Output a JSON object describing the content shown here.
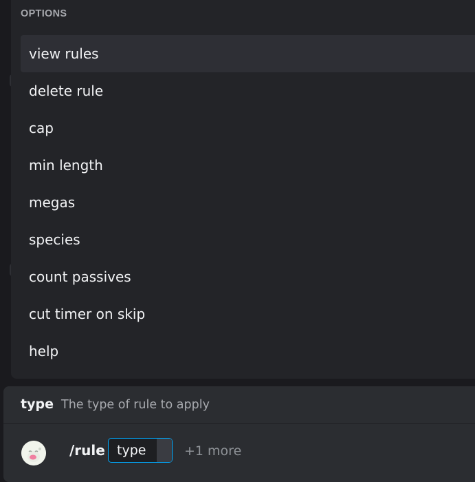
{
  "options": {
    "header": "OPTIONS",
    "items": [
      {
        "label": "view rules",
        "active": true
      },
      {
        "label": "delete rule",
        "active": false
      },
      {
        "label": "cap",
        "active": false
      },
      {
        "label": "min length",
        "active": false
      },
      {
        "label": "megas",
        "active": false
      },
      {
        "label": "species",
        "active": false
      },
      {
        "label": "count passives",
        "active": false
      },
      {
        "label": "cut timer on skip",
        "active": false
      },
      {
        "label": "help",
        "active": false
      }
    ]
  },
  "hint": {
    "param_name": "type",
    "description": "The type of rule to apply"
  },
  "composer": {
    "avatar_icon": "bot-avatar",
    "command": "/rule",
    "param_label": "type",
    "more": "+1 more"
  },
  "colors": {
    "focus_border": "#00a8fc",
    "panel_bg": "#232428",
    "active_item_bg": "#2e2f35"
  }
}
